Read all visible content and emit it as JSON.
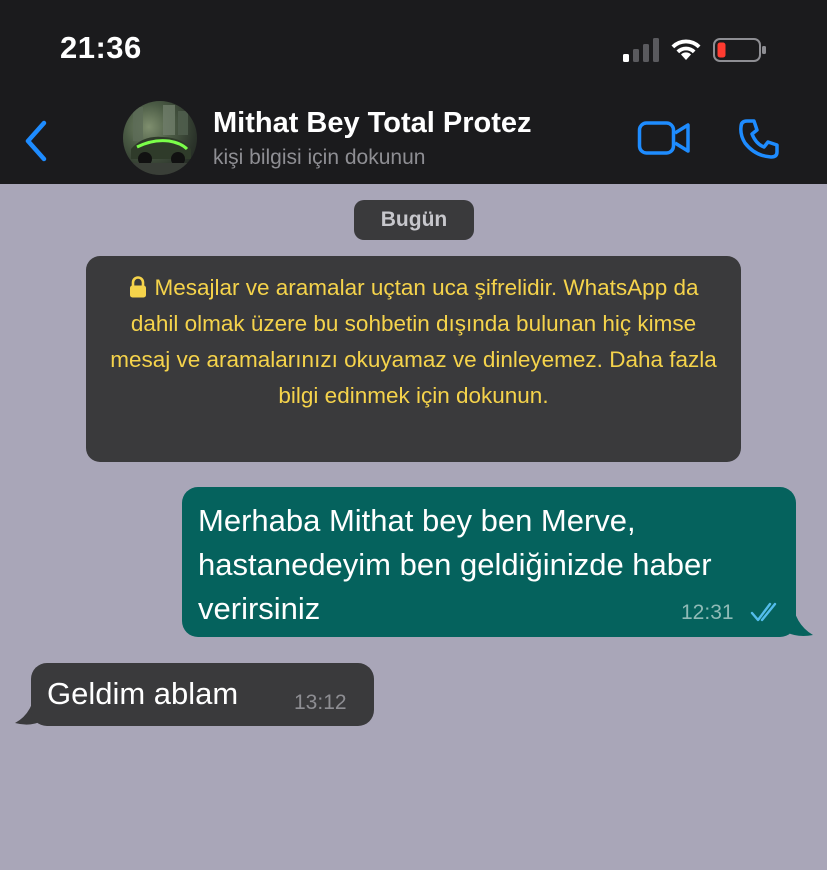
{
  "status_bar": {
    "time": "21:36",
    "icons": [
      "cellular-signal-icon",
      "wifi-icon",
      "battery-low-icon"
    ],
    "battery_color": "#ff3b30"
  },
  "header": {
    "back_icon": "chevron-left-icon",
    "contact_name": "Mithat Bey Total Protez",
    "subtitle": "kişi bilgisi için dokunun",
    "actions": [
      "video-call-icon",
      "phone-call-icon"
    ],
    "accent_color": "#1e8cff"
  },
  "chat": {
    "date_label": "Bugün",
    "encryption_notice": {
      "icon": "lock-icon",
      "text": "Mesajlar ve aramalar uçtan uca şifrelidir. WhatsApp da dahil olmak üzere bu sohbetin dışında bulunan hiç kimse mesaj ve aramalarınızı okuyamaz ve dinleyemez. Daha fazla bilgi edinmek için dokunun."
    },
    "messages": [
      {
        "direction": "outgoing",
        "text": "Merhaba Mithat bey ben Merve, hastanedeyim ben geldiğinizde haber verirsiniz",
        "time": "12:31",
        "status_icon": "double-check-read-icon"
      },
      {
        "direction": "incoming",
        "text": "Geldim ablam",
        "time": "13:12"
      }
    ]
  }
}
